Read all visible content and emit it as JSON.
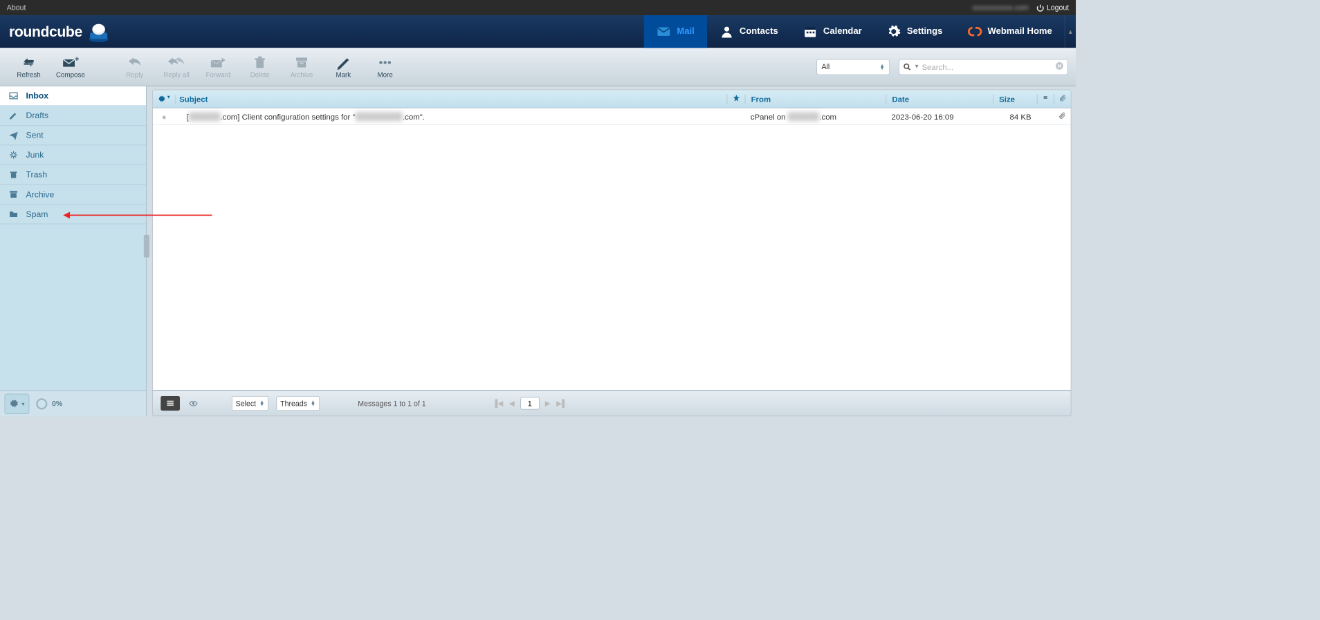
{
  "topbar": {
    "about": "About",
    "user_email": "xxxxxxxxxxx.com",
    "logout": "Logout"
  },
  "brand": {
    "name": "roundcube"
  },
  "nav": {
    "mail": "Mail",
    "contacts": "Contacts",
    "calendar": "Calendar",
    "settings": "Settings",
    "webmail_home": "Webmail Home"
  },
  "toolbar": {
    "refresh": "Refresh",
    "compose": "Compose",
    "reply": "Reply",
    "reply_all": "Reply all",
    "forward": "Forward",
    "delete": "Delete",
    "archive": "Archive",
    "mark": "Mark",
    "more": "More",
    "filter_value": "All",
    "search_placeholder": "Search..."
  },
  "folders": {
    "inbox": "Inbox",
    "drafts": "Drafts",
    "sent": "Sent",
    "junk": "Junk",
    "trash": "Trash",
    "archive": "Archive",
    "spam": "Spam"
  },
  "columns": {
    "subject": "Subject",
    "from": "From",
    "date": "Date",
    "size": "Size"
  },
  "messages": [
    {
      "subject_prefix": "[",
      "subject_blur1": "xxxxxxxx",
      "subject_mid": ".com] Client configuration settings for \"",
      "subject_blur2": "xxxxxxxxxxxx",
      "subject_suffix": ".com\".",
      "from_prefix": "cPanel on ",
      "from_blur": "xxxxxxxx",
      "from_suffix": ".com",
      "date": "2023-06-20 16:09",
      "size": "84 KB",
      "has_attachment": true
    }
  ],
  "footer": {
    "select_label": "Select",
    "threads_label": "Threads",
    "status": "Messages 1 to 1 of 1",
    "page": "1",
    "quota": "0%"
  }
}
